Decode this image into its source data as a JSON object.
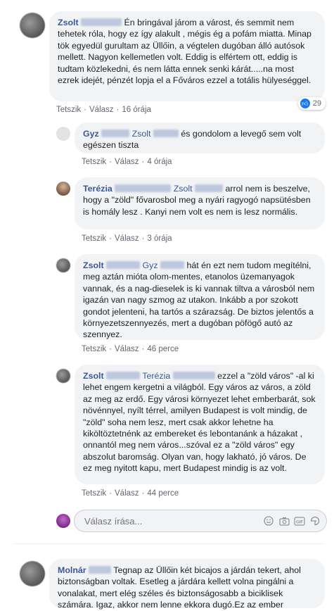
{
  "top_comment": {
    "author": "Zsolt",
    "text": "Én bringával járom a várost, és semmit nem tehetek róla, hogy ez így alakult , mégis ég a pofám miatta. Minap tök egyedül gurultam az Üllőin, a végtelen dugóban álló autósok mellett. Nagyon kellemetlen volt. Eddig is elfértem ott, eddig is tudtam közlekedni, és nem látta ennek senki kárát.....na most ezrek idejét, pénzét lopja el a Főváros ezzel a totális hülyeséggel.",
    "like_label": "Tetszik",
    "reply_label": "Válasz",
    "time": "16 órája",
    "reactions": "29"
  },
  "replies": [
    {
      "author": "Gyz",
      "mention": "Zsolt",
      "text": "és gondolom a levegő sem volt egészen tiszta",
      "like_label": "Tetszik",
      "reply_label": "Válasz",
      "time": "4 órája"
    },
    {
      "author": "Terézia",
      "mention": "Zsolt",
      "text": "arrol nem is beszelve, hogy a \"zöld\" fővarosbol meg a nyári ragyogó napsütésben is homály lesz . Kanyi nem volt es nem is lesz normális.",
      "like_label": "Tetszik",
      "reply_label": "Válasz",
      "time": "3 órája"
    },
    {
      "author": "Zsolt",
      "mention": "Gyz",
      "text": "hát én ezt nem tudom megítélni, meg aztán mióta olom-mentes, etanolos üzemanyagok vannak, és a nag-dieselek is ki vannak tiltva a városból nem igazán van nagy szmog az utakon. Inkább a por szokott gondot jelenteni, ha tartós a szárazság. De biztos jelentős a környezetszennyezés, mert a dugóban pöfögő autó az szennyez.",
      "like_label": "Tetszik",
      "reply_label": "Válasz",
      "time": "46 perce"
    },
    {
      "author": "Zsolt",
      "mention": "Terézia",
      "text": "ezzel a \"zöld város\" -al ki lehet engem kergetni a világból. Egy város az város, a zöld az meg az erdő. Egy városi környezet lehet emberbarát, sok növénnyel, nyílt térrel, amilyen Budapest is volt mindig, de \"zöld\" soha nem lesz, mert csak akkor lehetne ha kiköltöztetnénk az embereket és lebontanánk a házakat , onnantól meg nem város...szóval ez a \"zöld város\" egy abszolut baromság. Olyan van, hogy lakható, jó város. De ez meg nyitott kapu, mert Budapest mindig is az volt.",
      "like_label": "Tetszik",
      "reply_label": "Válasz",
      "time": "44 perce"
    }
  ],
  "reply_box": {
    "placeholder": "Válasz írása..."
  },
  "bottom_comment": {
    "author": "Molnár",
    "text": "Tegnap az Üllőin két bicajos a járdán tekert, ahol biztonságban voltak. Esetleg a járdára kellett volna pingálni a vonalakat, mert elég széles és biztonságosabb a biciklisek számára. Igaz, akkor nem lenne ekkora dugó.Ez az ember"
  }
}
